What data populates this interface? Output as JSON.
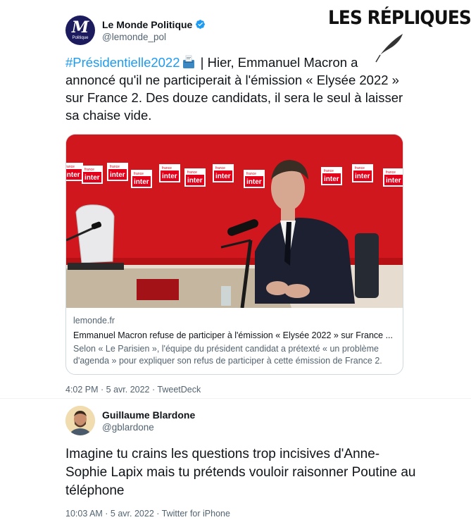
{
  "watermark": {
    "text": "LES RÉPLIQUES"
  },
  "tweet1": {
    "display_name": "Le Monde Politique",
    "handle": "@lemonde_pol",
    "avatar_letter": "M",
    "avatar_sub": "Politique",
    "hashtag": "#Présidentielle2022",
    "emoji": "ballot-box",
    "text": " | Hier, Emmanuel Macron a annoncé qu'il ne participerait à l'émission « Elysée 2022 » sur France 2. Des douze candidats, il sera le seul à laisser sa chaise vide.",
    "card": {
      "domain": "lemonde.fr",
      "title": "Emmanuel Macron refuse de participer à l'émission « Elysée 2022 » sur France ...",
      "description": "Selon « Le Parisien », l'équipe du président candidat a prétexté « un problème d'agenda » pour expliquer son refus de participer à cette émission de France 2.",
      "logo_text_top": "france",
      "logo_text": "inter"
    },
    "meta": "4:02 PM · 5 avr. 2022 · TweetDeck"
  },
  "tweet2": {
    "display_name": "Guillaume Blardone",
    "handle": "@gblardone",
    "text": "Imagine tu crains les questions trop incisives d'Anne-Sophie Lapix mais tu prétends vouloir raisonner Poutine au téléphone",
    "meta": "10:03 AM · 5 avr. 2022 · Twitter for iPhone"
  },
  "colors": {
    "link": "#1d9bf0",
    "verified": "#1d9bf0",
    "muted": "#536471",
    "studio_red": "#d0171e"
  }
}
